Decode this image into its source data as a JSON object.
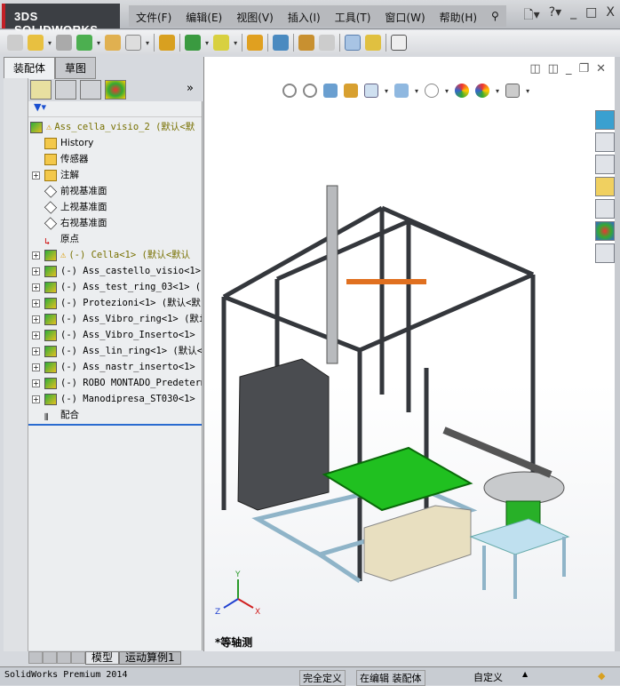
{
  "app": {
    "logo": "3DS SOLIDWORKS"
  },
  "menu": [
    "文件(F)",
    "编辑(E)",
    "视图(V)",
    "插入(I)",
    "工具(T)",
    "窗口(W)",
    "帮助(H)"
  ],
  "window_controls": [
    "_",
    "□",
    "X"
  ],
  "left_tabs": [
    "装配体",
    "草图"
  ],
  "tree": {
    "root": "Ass_cella_visio_2 (默认<默",
    "items": [
      {
        "label": "History",
        "icon": "history-folder-icon",
        "expand": false,
        "style": "plain"
      },
      {
        "label": "传感器",
        "icon": "sensor-folder-icon",
        "expand": false,
        "style": "plain"
      },
      {
        "label": "注解",
        "icon": "annotation-folder-icon",
        "expand": true,
        "style": "plain"
      },
      {
        "label": "前视基准面",
        "icon": "plane-icon",
        "expand": false,
        "style": "plain"
      },
      {
        "label": "上视基准面",
        "icon": "plane-icon",
        "expand": false,
        "style": "plain"
      },
      {
        "label": "右视基准面",
        "icon": "plane-icon",
        "expand": false,
        "style": "plain"
      },
      {
        "label": "原点",
        "icon": "origin-icon",
        "expand": false,
        "style": "plain"
      },
      {
        "label": "(-) Cella<1> (默认<默认",
        "icon": "assembly-icon",
        "expand": true,
        "style": "warn"
      },
      {
        "label": "(-) Ass_castello_visio<1>",
        "icon": "assembly-icon",
        "expand": true,
        "style": "asm"
      },
      {
        "label": "(-) Ass_test_ring_03<1> (",
        "icon": "assembly-icon",
        "expand": true,
        "style": "asm"
      },
      {
        "label": "(-) Protezioni<1> (默认<默",
        "icon": "assembly-icon",
        "expand": true,
        "style": "asm"
      },
      {
        "label": "(-) Ass_Vibro_ring<1> (默i",
        "icon": "assembly-icon",
        "expand": true,
        "style": "asm"
      },
      {
        "label": "(-) Ass_Vibro_Inserto<1>",
        "icon": "assembly-icon",
        "expand": true,
        "style": "asm"
      },
      {
        "label": "(-) Ass_lin_ring<1> (默认<",
        "icon": "assembly-icon",
        "expand": true,
        "style": "asm"
      },
      {
        "label": "(-) Ass_nastr_inserto<1>",
        "icon": "assembly-icon",
        "expand": true,
        "style": "asm"
      },
      {
        "label": "(-) ROBO MONTADO_Predeterm",
        "icon": "assembly-icon",
        "expand": true,
        "style": "asm"
      },
      {
        "label": "(-) Manodipresa_ST030<1>",
        "icon": "assembly-icon",
        "expand": true,
        "style": "asm"
      },
      {
        "label": "配合",
        "icon": "mates-icon",
        "expand": false,
        "style": "plain"
      }
    ]
  },
  "view": {
    "name": "*等轴测",
    "triad": {
      "x": "X",
      "y": "Y",
      "z": "Z"
    }
  },
  "bottom_tabs": [
    "模型",
    "运动算例1"
  ],
  "status": {
    "product": "SolidWorks Premium 2014",
    "state": "完全定义",
    "editing": "在编辑 装配体",
    "units": "自定义"
  },
  "colors": {
    "accent": "#2a6bd0",
    "warn": "#d99a00",
    "frame": "#3a3d42",
    "belt": "#22c522"
  }
}
